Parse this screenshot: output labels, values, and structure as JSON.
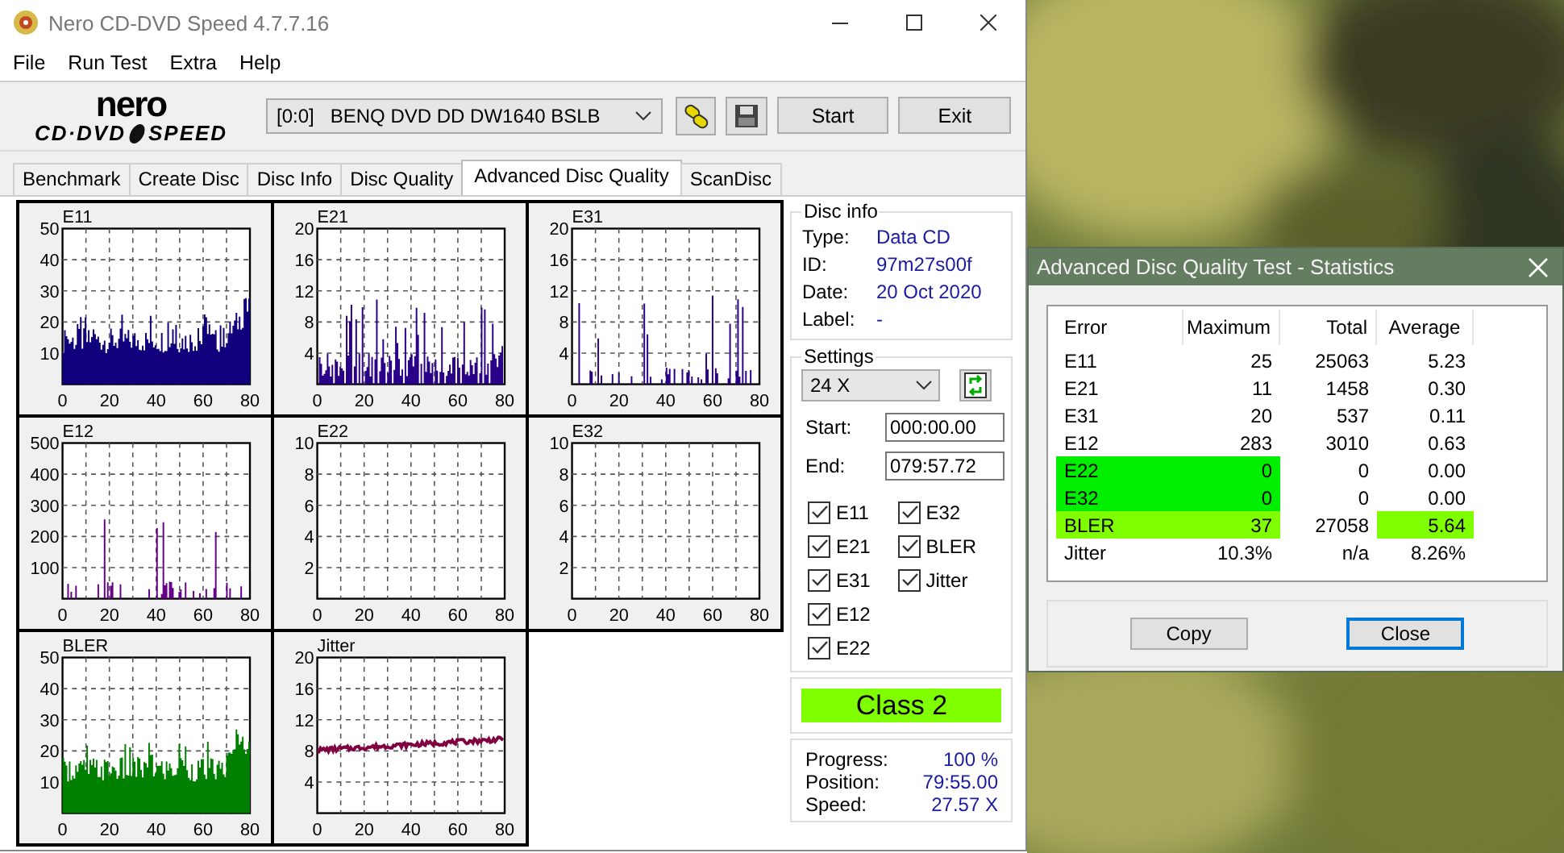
{
  "window": {
    "title": "Nero CD-DVD Speed 4.7.7.16"
  },
  "menu": [
    "File",
    "Run Test",
    "Extra",
    "Help"
  ],
  "logo": {
    "top": "nero",
    "left": "CD·DVD",
    "right": "SPEED"
  },
  "drive": {
    "value": "[0:0]   BENQ DVD DD DW1640 BSLB"
  },
  "buttons": [
    "Start",
    "Exit"
  ],
  "tabs": [
    {
      "label": "Benchmark",
      "selected": false
    },
    {
      "label": "Create Disc",
      "selected": false
    },
    {
      "label": "Disc Info",
      "selected": false
    },
    {
      "label": "Disc Quality",
      "selected": false
    },
    {
      "label": "Advanced Disc Quality",
      "selected": true
    },
    {
      "label": "ScanDisc",
      "selected": false
    }
  ],
  "charts": [
    {
      "title": "E11",
      "kind": "bars",
      "color": "#10007c",
      "yticks": [
        "50",
        "40",
        "30",
        "20",
        "10"
      ],
      "xticks": [
        "0",
        "20",
        "40",
        "60",
        "80"
      ]
    },
    {
      "title": "E21",
      "kind": "spikes",
      "color": "#2a0088",
      "yticks": [
        "20",
        "16",
        "12",
        "8",
        "4"
      ],
      "xticks": [
        "0",
        "20",
        "40",
        "60",
        "80"
      ]
    },
    {
      "title": "E31",
      "kind": "sparse",
      "color": "#2a0088",
      "yticks": [
        "20",
        "16",
        "12",
        "8",
        "4"
      ],
      "xticks": [
        "0",
        "20",
        "40",
        "60",
        "80"
      ]
    },
    {
      "title": "E12",
      "kind": "sparse",
      "color": "#660088",
      "yticks": [
        "500",
        "400",
        "300",
        "200",
        "100"
      ],
      "xticks": [
        "0",
        "20",
        "40",
        "60",
        "80"
      ]
    },
    {
      "title": "E22",
      "kind": "empty",
      "yticks": [
        "10",
        "8",
        "6",
        "4",
        "2"
      ],
      "xticks": [
        "0",
        "20",
        "40",
        "60",
        "80"
      ]
    },
    {
      "title": "E32",
      "kind": "empty",
      "yticks": [
        "10",
        "8",
        "6",
        "4",
        "2"
      ],
      "xticks": [
        "0",
        "20",
        "40",
        "60",
        "80"
      ]
    },
    {
      "title": "BLER",
      "kind": "bars",
      "color": "#008000",
      "yticks": [
        "50",
        "40",
        "30",
        "20",
        "10"
      ],
      "xticks": [
        "0",
        "20",
        "40",
        "60",
        "80"
      ]
    },
    {
      "title": "Jitter",
      "kind": "line",
      "color": "#800040",
      "yticks": [
        "20",
        "16",
        "12",
        "8",
        "4"
      ],
      "xticks": [
        "0",
        "20",
        "40",
        "60",
        "80"
      ]
    }
  ],
  "disc_info": {
    "legend": "Disc info",
    "rows": [
      {
        "label": "Type:",
        "value": "Data CD"
      },
      {
        "label": "ID:",
        "value": "97m27s00f"
      },
      {
        "label": "Date:",
        "value": "20 Oct 2020"
      },
      {
        "label": "Label:",
        "value": "-"
      }
    ]
  },
  "settings": {
    "legend": "Settings",
    "speed": "24 X",
    "start_label": "Start:",
    "start": "000:00.00",
    "end_label": "End:",
    "end": "079:57.72",
    "checks": [
      {
        "label": "E11",
        "checked": true
      },
      {
        "label": "E21",
        "checked": true
      },
      {
        "label": "E31",
        "checked": true
      },
      {
        "label": "E12",
        "checked": true
      },
      {
        "label": "E22",
        "checked": true
      },
      {
        "label": "E32",
        "checked": true
      },
      {
        "label": "BLER",
        "checked": true
      },
      {
        "label": "Jitter",
        "checked": true
      }
    ]
  },
  "class_badge": {
    "text": "Class 2",
    "color": "#80ff00"
  },
  "progress": [
    {
      "label": "Progress:",
      "value": "100 %"
    },
    {
      "label": "Position:",
      "value": "79:55.00"
    },
    {
      "label": "Speed:",
      "value": "27.57 X"
    }
  ],
  "stats_dialog": {
    "title": "Advanced Disc Quality Test - Statistics",
    "columns": [
      "Error",
      "Maximum",
      "Total",
      "Average"
    ],
    "rows": [
      {
        "error": "E11",
        "maximum": "25",
        "total": "25063",
        "average": "5.23"
      },
      {
        "error": "E21",
        "maximum": "11",
        "total": "1458",
        "average": "0.30"
      },
      {
        "error": "E31",
        "maximum": "20",
        "total": "537",
        "average": "0.11"
      },
      {
        "error": "E12",
        "maximum": "283",
        "total": "3010",
        "average": "0.63"
      },
      {
        "error": "E22",
        "maximum": "0",
        "total": "0",
        "average": "0.00",
        "color": "#00ee00"
      },
      {
        "error": "E32",
        "maximum": "0",
        "total": "0",
        "average": "0.00",
        "color": "#00ee00"
      },
      {
        "error": "BLER",
        "maximum": "37",
        "total": "27058",
        "average": "5.64",
        "color": "#80ff00",
        "average_highlighted": true
      },
      {
        "error": "Jitter",
        "maximum": "10.3%",
        "total": "n/a",
        "average": "8.26%"
      }
    ],
    "buttons": [
      {
        "label": "Copy",
        "focused": false
      },
      {
        "label": "Close",
        "focused": true
      }
    ]
  }
}
